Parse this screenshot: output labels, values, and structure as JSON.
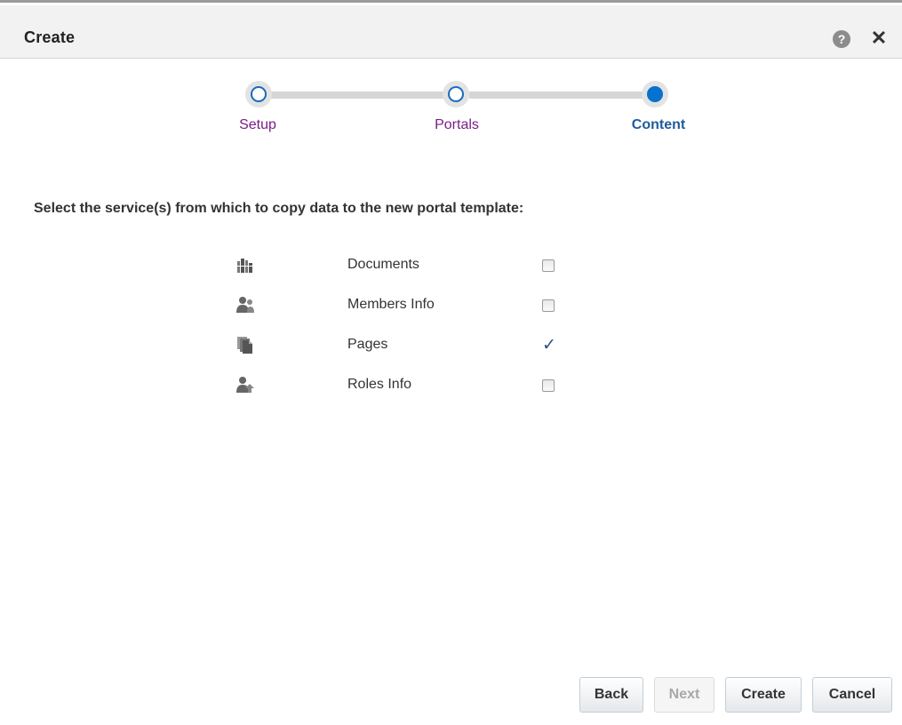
{
  "dialog": {
    "title": "Create",
    "help_icon": "help-icon",
    "help_glyph": "?",
    "close_icon": "close-icon",
    "close_glyph": "✕"
  },
  "train": {
    "steps": [
      {
        "label": "Setup",
        "state": "visited"
      },
      {
        "label": "Portals",
        "state": "visited"
      },
      {
        "label": "Content",
        "state": "current"
      }
    ]
  },
  "content": {
    "instruction": "Select the service(s) from which to copy data to the new portal template:",
    "services": [
      {
        "icon": "documents-icon",
        "label": "Documents",
        "checked": false
      },
      {
        "icon": "members-icon",
        "label": "Members Info",
        "checked": false
      },
      {
        "icon": "pages-icon",
        "label": "Pages",
        "checked": true,
        "checkmark": "✓"
      },
      {
        "icon": "roles-icon",
        "label": "Roles Info",
        "checked": false
      }
    ]
  },
  "buttons": {
    "back": {
      "label": "Back",
      "enabled": true
    },
    "next": {
      "label": "Next",
      "enabled": false
    },
    "create": {
      "label": "Create",
      "enabled": true
    },
    "cancel": {
      "label": "Cancel",
      "enabled": true
    }
  },
  "colors": {
    "visited_step": "#7a1e87",
    "current_step": "#1f5c99",
    "current_dot": "#0572ce",
    "checkmark": "#2b4e8c"
  }
}
